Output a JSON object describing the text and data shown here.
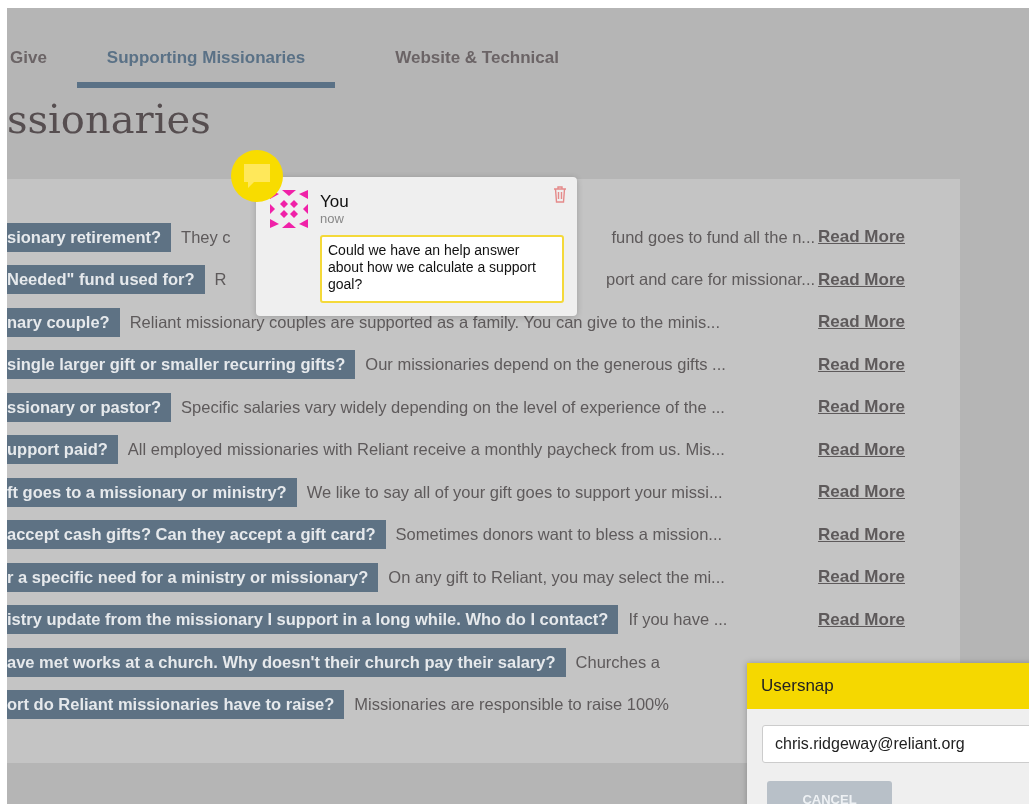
{
  "tabs": [
    {
      "label": "Give",
      "selected": false
    },
    {
      "label": "Supporting Missionaries",
      "selected": true
    },
    {
      "label": "Website & Technical",
      "selected": false
    }
  ],
  "heading": "ssionaries",
  "faq": [
    {
      "question": "sionary retirement?",
      "answer": "They c",
      "answer_tail": "fund goes to fund all the n...",
      "read_more": "Read More"
    },
    {
      "question": "Needed\" fund used for?",
      "answer": "R",
      "answer_tail": "port and care for missionar...",
      "read_more": "Read More"
    },
    {
      "question": "nary couple?",
      "answer": "Reliant missionary couples are supported as a family. You can give to the minis...",
      "read_more": "Read More"
    },
    {
      "question": "single larger gift or smaller recurring gifts?",
      "answer": "Our missionaries depend on the generous gifts ...",
      "read_more": "Read More"
    },
    {
      "question": "ssionary or pastor?",
      "answer": "Specific salaries vary widely depending on the level of experience of the ...",
      "read_more": "Read More"
    },
    {
      "question": "upport paid?",
      "answer": "All employed missionaries with Reliant receive a monthly paycheck from us. Mis...",
      "read_more": "Read More"
    },
    {
      "question": "ft goes to a missionary or ministry?",
      "answer": "We like to say all of your gift goes to support your missi...",
      "read_more": "Read More"
    },
    {
      "question": "accept cash gifts? Can they accept a gift card?",
      "answer": "Sometimes donors want to bless a mission...",
      "read_more": "Read More"
    },
    {
      "question": "r a specific need for a ministry or missionary?",
      "answer": "On any gift to Reliant, you may select the mi...",
      "read_more": "Read More"
    },
    {
      "question": "istry update from the missionary I support in a long while. Who do I contact?",
      "answer": "If you have ...",
      "read_more": "Read More"
    },
    {
      "question": "ave met works at a church. Why doesn't their church pay their salary?",
      "answer": "Churches a"
    },
    {
      "question": "ort do Reliant missionaries have to raise?",
      "answer": "Missionaries are responsible to raise 100%"
    }
  ],
  "comment": {
    "author": "You",
    "time": "now",
    "text": "Could we have an help answer about how we calculate a support goal?"
  },
  "usersnap": {
    "title": "Usersnap",
    "email": "chris.ridgeway@reliant.org",
    "cancel": "CANCEL"
  }
}
